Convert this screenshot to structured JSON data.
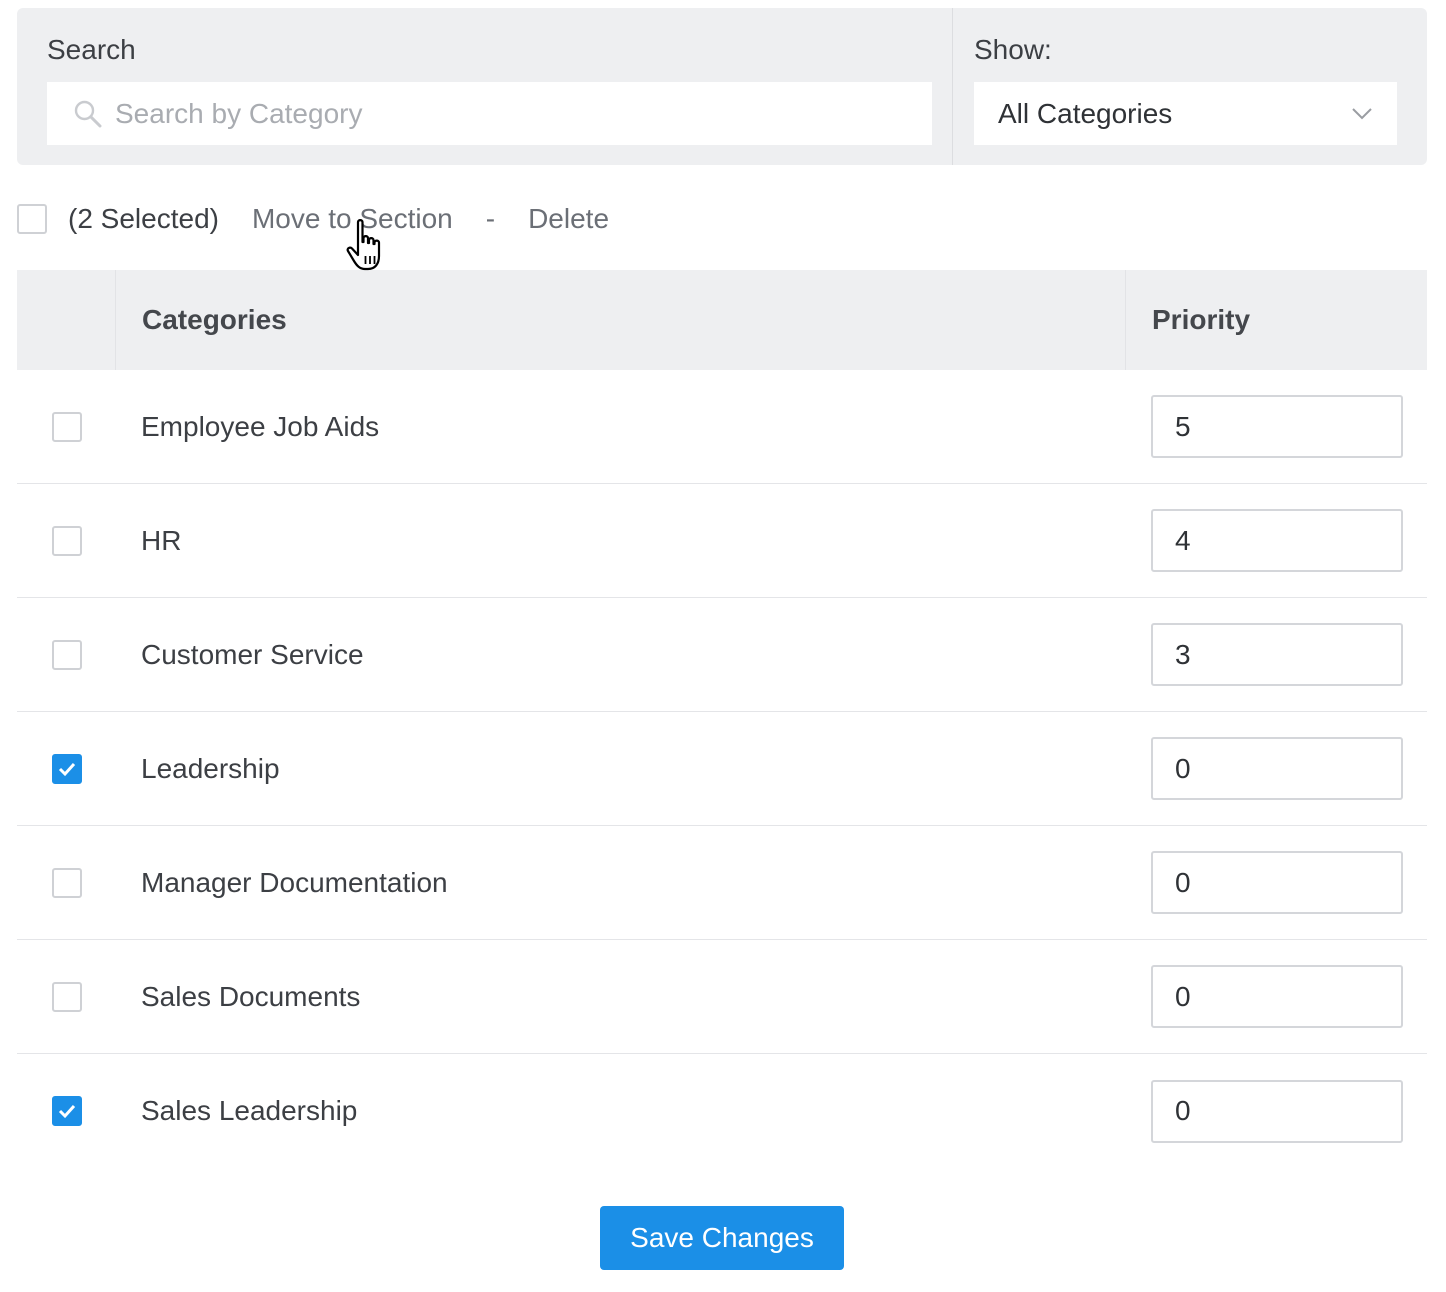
{
  "filters": {
    "search": {
      "label": "Search",
      "placeholder": "Search by Category",
      "value": "",
      "icon": "search-icon"
    },
    "show": {
      "label": "Show:",
      "selected": "All Categories",
      "icon": "chevron-down-icon"
    }
  },
  "bulk_actions": {
    "selected_count_text": "(2 Selected)",
    "move_label": "Move to Section",
    "separator": "-",
    "delete_label": "Delete"
  },
  "table": {
    "headers": {
      "categories": "Categories",
      "priority": "Priority"
    },
    "rows": [
      {
        "category": "Employee Job Aids",
        "priority": "5",
        "checked": false
      },
      {
        "category": "HR",
        "priority": "4",
        "checked": false
      },
      {
        "category": "Customer Service",
        "priority": "3",
        "checked": false
      },
      {
        "category": "Leadership",
        "priority": "0",
        "checked": true
      },
      {
        "category": "Manager Documentation",
        "priority": "0",
        "checked": false
      },
      {
        "category": "Sales Documents",
        "priority": "0",
        "checked": false
      },
      {
        "category": "Sales Leadership",
        "priority": "0",
        "checked": true
      }
    ]
  },
  "save_button": {
    "label": "Save Changes"
  },
  "colors": {
    "accent": "#1b8fe7",
    "panel_bg": "#eeeff1",
    "text": "#3c3f44",
    "muted_text": "#6b6f76",
    "placeholder": "#a9acb1"
  }
}
